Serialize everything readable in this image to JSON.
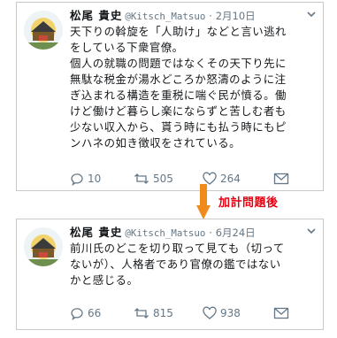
{
  "tweets": [
    {
      "name": "松尾 貴史",
      "handle": "@Kitsch_Matsuo",
      "dot": "·",
      "date": "2月10日",
      "lines": [
        "天下りの斡旋を「人助け」などと言い逃れ",
        "をしている下衆官僚。",
        "個人の就職の問題ではなくその天下り先に",
        "無駄な税金が湯水どころか怒濤のように注",
        "ぎ込まれる構造を重税に喘ぐ民が憤る。働",
        "けど働けど暮らし楽にならずと苦しむ者も",
        "少ない収入から、貰う時にも払う時にもピ",
        "ンハネの如き徴収をされている。"
      ],
      "replies": "10",
      "retweets": "505",
      "likes": "264"
    },
    {
      "name": "松尾 貴史",
      "handle": "@Kitsch_Matsuo",
      "dot": "·",
      "date": "6月24日",
      "lines": [
        "前川氏のどこを切り取って見ても（切って",
        "ないが）、人格者であり官僚の鑑ではない",
        "かと感じる。"
      ],
      "replies": "66",
      "retweets": "815",
      "likes": "938"
    }
  ],
  "annotation": {
    "label": "加計問題後",
    "color": "#e60012",
    "arrow_color": "#f08a1c"
  },
  "colors": {
    "text": "#14171a",
    "muted": "#657786",
    "border": "#c9c9c9"
  },
  "icons": [
    "reply-icon",
    "retweet-icon",
    "like-icon",
    "dm-icon",
    "caret-down-icon"
  ]
}
